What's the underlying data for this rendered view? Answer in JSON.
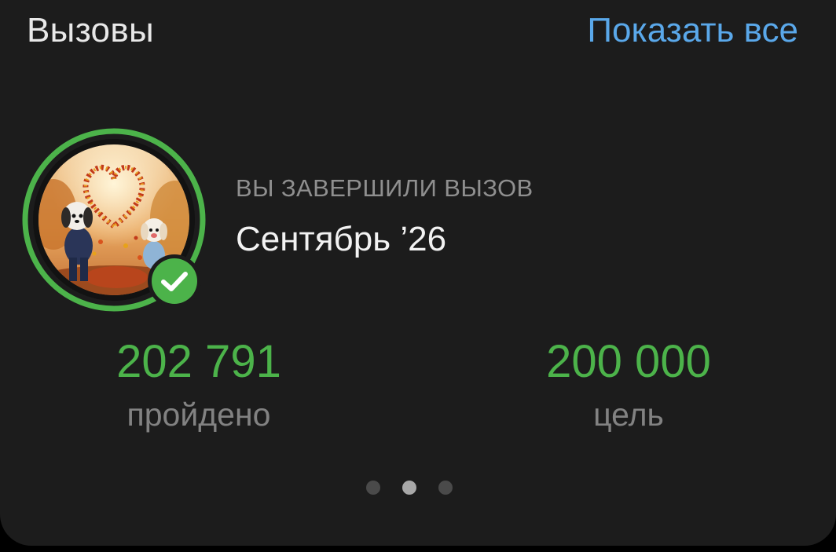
{
  "header": {
    "title": "Вызовы",
    "show_all_label": "Показать все"
  },
  "challenge": {
    "status_label": "ВЫ ЗАВЕРШИЛИ ВЫЗОВ",
    "name": "Сентябрь ’26",
    "badge_icon": "autumn-dogs-heart-image",
    "completed_icon": "check-icon"
  },
  "stats": {
    "completed_value": "202 791",
    "completed_label": "пройдено",
    "goal_value": "200 000",
    "goal_label": "цель"
  },
  "pagination": {
    "total_pages": 3,
    "active_page": 2
  },
  "colors": {
    "accent_green": "#4cb34a",
    "link_blue": "#5aa8ea",
    "card_bg": "#1c1c1c"
  }
}
